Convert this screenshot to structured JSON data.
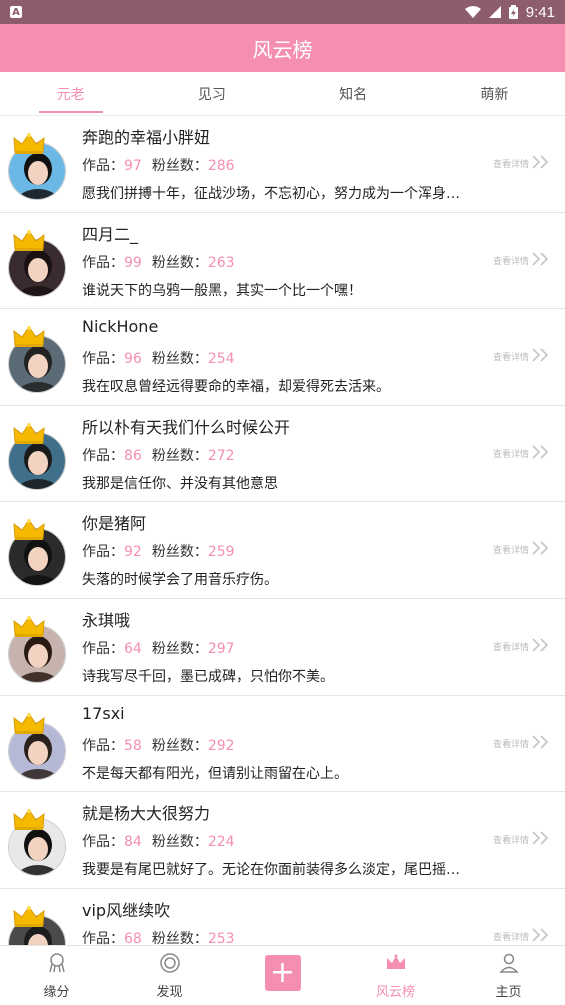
{
  "status_bar": {
    "time": "9:41",
    "left_badge": "A"
  },
  "title": "风云榜",
  "tabs": [
    {
      "label": "元老",
      "active": true
    },
    {
      "label": "见习",
      "active": false
    },
    {
      "label": "知名",
      "active": false
    },
    {
      "label": "萌新",
      "active": false
    }
  ],
  "labels": {
    "works": "作品：",
    "fans": "粉丝数：",
    "detail": "查看详情"
  },
  "users": [
    {
      "name": "奔跑的幸福小胖妞",
      "works": "97",
      "fans": "286",
      "motto": "愿我们拼搏十年，征战沙场，不忘初心，努力成为一个浑身…",
      "avatar_color": "#6bb7e6"
    },
    {
      "name": "四月二_",
      "works": "99",
      "fans": "263",
      "motto": "谁说天下的乌鸦一般黑，其实一个比一个嘿！",
      "avatar_color": "#3a2b2e"
    },
    {
      "name": "NickHone",
      "works": "96",
      "fans": "254",
      "motto": "我在叹息曾经远得要命的幸福，却爱得死去活来。",
      "avatar_color": "#5b6b76"
    },
    {
      "name": "所以朴有天我们什么时候公开",
      "works": "86",
      "fans": "272",
      "motto": "我那是信任你、并没有其他意思",
      "avatar_color": "#3f6f8a"
    },
    {
      "name": "你是猪阿",
      "works": "92",
      "fans": "259",
      "motto": "失落的时候学会了用音乐疗伤。",
      "avatar_color": "#2d2a2c"
    },
    {
      "name": "永琪哦",
      "works": "64",
      "fans": "297",
      "motto": "诗我写尽千回，墨已成碑，只怕你不美。",
      "avatar_color": "#c7b3ad"
    },
    {
      "name": "17sxi",
      "works": "58",
      "fans": "292",
      "motto": "不是每天都有阳光，但请别让雨留在心上。",
      "avatar_color": "#b5b9d6"
    },
    {
      "name": "就是杨大大很努力",
      "works": "84",
      "fans": "224",
      "motto": "我要是有尾巴就好了。无论在你面前装得多么淡定，尾巴摇…",
      "avatar_color": "#e8e8e8"
    },
    {
      "name": "vip风继续吹",
      "works": "68",
      "fans": "253",
      "motto": "",
      "avatar_color": "#4a4a4a"
    }
  ],
  "bottom_nav": [
    {
      "label": "缘分",
      "icon": "fate-icon",
      "active": false
    },
    {
      "label": "发现",
      "icon": "discover-icon",
      "active": false
    },
    {
      "label": "",
      "icon": "plus-icon",
      "active": false
    },
    {
      "label": "风云榜",
      "icon": "crown-icon",
      "active": true
    },
    {
      "label": "主页",
      "icon": "person-icon",
      "active": false
    }
  ],
  "colors": {
    "accent": "#f58fb1",
    "status_bar": "#8e5d6d",
    "crown": "#f5b900"
  }
}
